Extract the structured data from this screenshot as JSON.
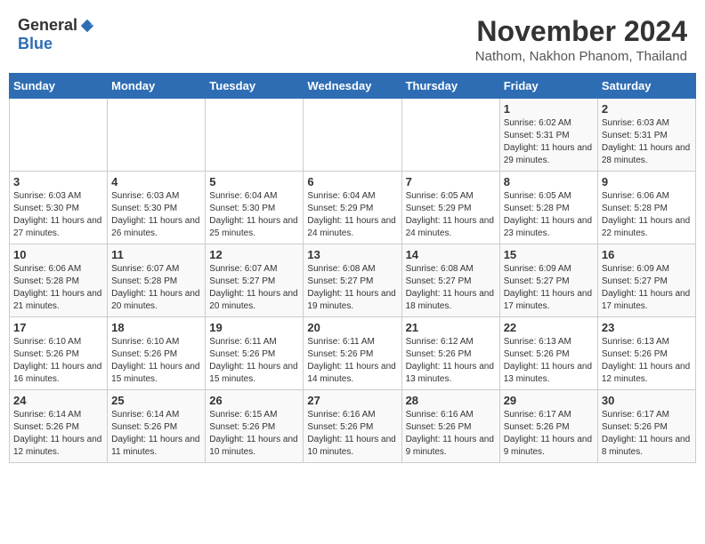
{
  "header": {
    "logo_general": "General",
    "logo_blue": "Blue",
    "month": "November 2024",
    "location": "Nathom, Nakhon Phanom, Thailand"
  },
  "weekdays": [
    "Sunday",
    "Monday",
    "Tuesday",
    "Wednesday",
    "Thursday",
    "Friday",
    "Saturday"
  ],
  "weeks": [
    [
      {
        "day": "",
        "info": ""
      },
      {
        "day": "",
        "info": ""
      },
      {
        "day": "",
        "info": ""
      },
      {
        "day": "",
        "info": ""
      },
      {
        "day": "",
        "info": ""
      },
      {
        "day": "1",
        "info": "Sunrise: 6:02 AM\nSunset: 5:31 PM\nDaylight: 11 hours and 29 minutes."
      },
      {
        "day": "2",
        "info": "Sunrise: 6:03 AM\nSunset: 5:31 PM\nDaylight: 11 hours and 28 minutes."
      }
    ],
    [
      {
        "day": "3",
        "info": "Sunrise: 6:03 AM\nSunset: 5:30 PM\nDaylight: 11 hours and 27 minutes."
      },
      {
        "day": "4",
        "info": "Sunrise: 6:03 AM\nSunset: 5:30 PM\nDaylight: 11 hours and 26 minutes."
      },
      {
        "day": "5",
        "info": "Sunrise: 6:04 AM\nSunset: 5:30 PM\nDaylight: 11 hours and 25 minutes."
      },
      {
        "day": "6",
        "info": "Sunrise: 6:04 AM\nSunset: 5:29 PM\nDaylight: 11 hours and 24 minutes."
      },
      {
        "day": "7",
        "info": "Sunrise: 6:05 AM\nSunset: 5:29 PM\nDaylight: 11 hours and 24 minutes."
      },
      {
        "day": "8",
        "info": "Sunrise: 6:05 AM\nSunset: 5:28 PM\nDaylight: 11 hours and 23 minutes."
      },
      {
        "day": "9",
        "info": "Sunrise: 6:06 AM\nSunset: 5:28 PM\nDaylight: 11 hours and 22 minutes."
      }
    ],
    [
      {
        "day": "10",
        "info": "Sunrise: 6:06 AM\nSunset: 5:28 PM\nDaylight: 11 hours and 21 minutes."
      },
      {
        "day": "11",
        "info": "Sunrise: 6:07 AM\nSunset: 5:28 PM\nDaylight: 11 hours and 20 minutes."
      },
      {
        "day": "12",
        "info": "Sunrise: 6:07 AM\nSunset: 5:27 PM\nDaylight: 11 hours and 20 minutes."
      },
      {
        "day": "13",
        "info": "Sunrise: 6:08 AM\nSunset: 5:27 PM\nDaylight: 11 hours and 19 minutes."
      },
      {
        "day": "14",
        "info": "Sunrise: 6:08 AM\nSunset: 5:27 PM\nDaylight: 11 hours and 18 minutes."
      },
      {
        "day": "15",
        "info": "Sunrise: 6:09 AM\nSunset: 5:27 PM\nDaylight: 11 hours and 17 minutes."
      },
      {
        "day": "16",
        "info": "Sunrise: 6:09 AM\nSunset: 5:27 PM\nDaylight: 11 hours and 17 minutes."
      }
    ],
    [
      {
        "day": "17",
        "info": "Sunrise: 6:10 AM\nSunset: 5:26 PM\nDaylight: 11 hours and 16 minutes."
      },
      {
        "day": "18",
        "info": "Sunrise: 6:10 AM\nSunset: 5:26 PM\nDaylight: 11 hours and 15 minutes."
      },
      {
        "day": "19",
        "info": "Sunrise: 6:11 AM\nSunset: 5:26 PM\nDaylight: 11 hours and 15 minutes."
      },
      {
        "day": "20",
        "info": "Sunrise: 6:11 AM\nSunset: 5:26 PM\nDaylight: 11 hours and 14 minutes."
      },
      {
        "day": "21",
        "info": "Sunrise: 6:12 AM\nSunset: 5:26 PM\nDaylight: 11 hours and 13 minutes."
      },
      {
        "day": "22",
        "info": "Sunrise: 6:13 AM\nSunset: 5:26 PM\nDaylight: 11 hours and 13 minutes."
      },
      {
        "day": "23",
        "info": "Sunrise: 6:13 AM\nSunset: 5:26 PM\nDaylight: 11 hours and 12 minutes."
      }
    ],
    [
      {
        "day": "24",
        "info": "Sunrise: 6:14 AM\nSunset: 5:26 PM\nDaylight: 11 hours and 12 minutes."
      },
      {
        "day": "25",
        "info": "Sunrise: 6:14 AM\nSunset: 5:26 PM\nDaylight: 11 hours and 11 minutes."
      },
      {
        "day": "26",
        "info": "Sunrise: 6:15 AM\nSunset: 5:26 PM\nDaylight: 11 hours and 10 minutes."
      },
      {
        "day": "27",
        "info": "Sunrise: 6:16 AM\nSunset: 5:26 PM\nDaylight: 11 hours and 10 minutes."
      },
      {
        "day": "28",
        "info": "Sunrise: 6:16 AM\nSunset: 5:26 PM\nDaylight: 11 hours and 9 minutes."
      },
      {
        "day": "29",
        "info": "Sunrise: 6:17 AM\nSunset: 5:26 PM\nDaylight: 11 hours and 9 minutes."
      },
      {
        "day": "30",
        "info": "Sunrise: 6:17 AM\nSunset: 5:26 PM\nDaylight: 11 hours and 8 minutes."
      }
    ]
  ]
}
